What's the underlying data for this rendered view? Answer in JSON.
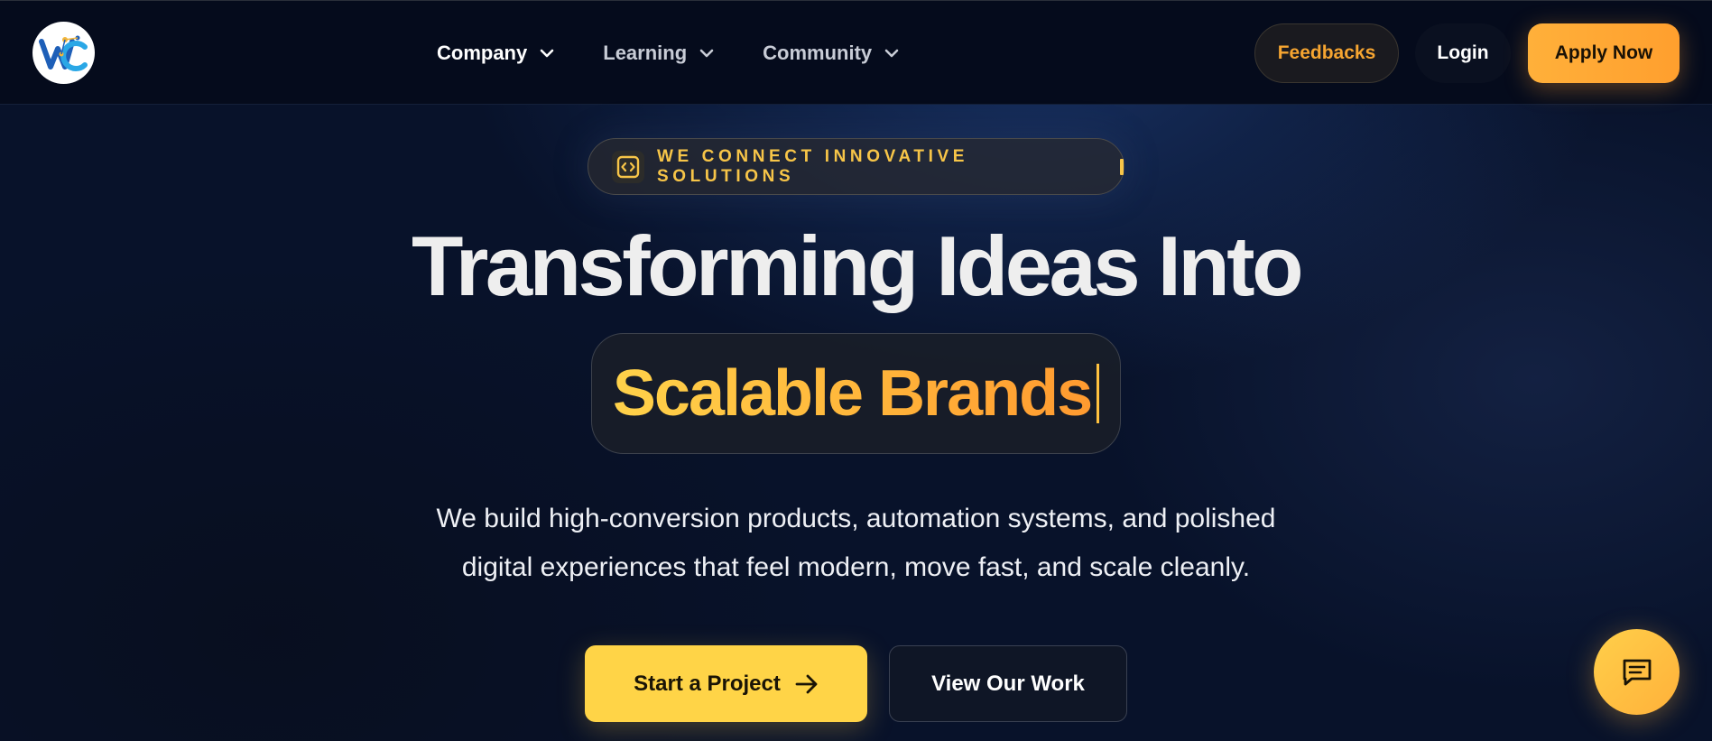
{
  "nav": {
    "logo_alt": "WC",
    "menu": [
      {
        "label": "Company"
      },
      {
        "label": "Learning"
      },
      {
        "label": "Community"
      }
    ],
    "feedback_label": "Feedbacks",
    "login_label": "Login",
    "apply_label": "Apply Now"
  },
  "hero": {
    "badge_text": "WE CONNECT INNOVATIVE SOLUTIONS",
    "headline": "Transforming Ideas Into",
    "highlight": "Scalable Brands",
    "subtitle_line1": "We build high-conversion products, automation systems, and polished",
    "subtitle_line2": "digital experiences that feel modern, move fast, and scale cleanly.",
    "cta_primary": "Start a Project",
    "cta_secondary": "View Our Work"
  },
  "colors": {
    "accent_orange": "#ff9f2e",
    "accent_yellow": "#ffd447",
    "background": "#08122a"
  },
  "icons": {
    "badge": "code-icon",
    "cta_primary": "arrow-right-icon",
    "chat": "chat-icon"
  }
}
